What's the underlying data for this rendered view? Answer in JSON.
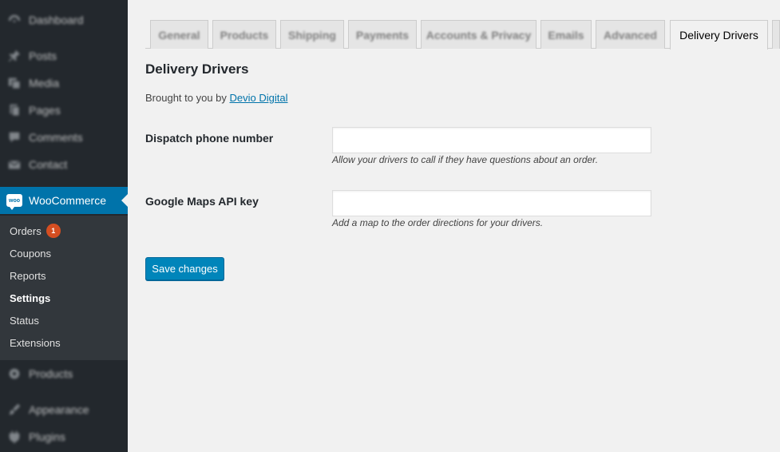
{
  "sidebar": {
    "top_items": [
      {
        "label": "Dashboard",
        "icon": "dashboard-icon"
      },
      {
        "label": "Posts",
        "icon": "pin-icon"
      },
      {
        "label": "Media",
        "icon": "media-icon"
      },
      {
        "label": "Pages",
        "icon": "pages-icon"
      },
      {
        "label": "Comments",
        "icon": "comment-icon"
      },
      {
        "label": "Contact",
        "icon": "mail-icon"
      }
    ],
    "woocommerce": {
      "label": "WooCommerce",
      "logo_text": "woo"
    },
    "submenu": [
      {
        "label": "Orders",
        "badge": "1"
      },
      {
        "label": "Coupons"
      },
      {
        "label": "Reports"
      },
      {
        "label": "Settings"
      },
      {
        "label": "Status"
      },
      {
        "label": "Extensions"
      }
    ],
    "bottom_items": [
      {
        "label": "Products",
        "icon": "products-icon"
      },
      {
        "label": "Appearance",
        "icon": "brush-icon"
      },
      {
        "label": "Plugins",
        "icon": "plugin-icon"
      }
    ]
  },
  "tabs": [
    "General",
    "Products",
    "Shipping",
    "Payments",
    "Accounts & Privacy",
    "Emails",
    "Advanced",
    "Delivery Drivers"
  ],
  "content": {
    "title": "Delivery Drivers",
    "credit_prefix": "Brought to you by ",
    "credit_link": "Devio Digital",
    "fields": [
      {
        "label": "Dispatch phone number",
        "value": "",
        "description": "Allow your drivers to call if they have questions about an order."
      },
      {
        "label": "Google Maps API key",
        "value": "",
        "description": "Add a map to the order directions for your drivers."
      }
    ],
    "save_label": "Save changes"
  },
  "colors": {
    "sidebar": "#23282d",
    "submenu": "#32373c",
    "accent": "#0073aa",
    "button": "#0085ba",
    "badge": "#d54e21"
  }
}
